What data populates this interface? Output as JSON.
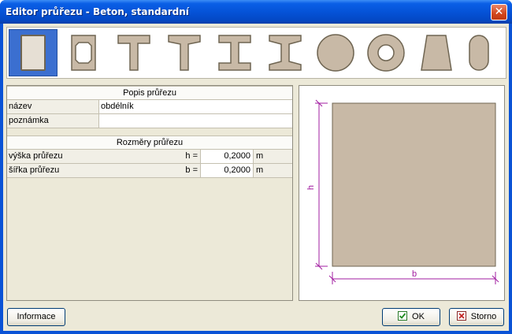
{
  "window": {
    "title": "Editor průřezu - Beton, standardní",
    "close_glyph": "✕"
  },
  "shapes": [
    {
      "name": "rectangle",
      "selected": true
    },
    {
      "name": "hollow-rectangle",
      "selected": false
    },
    {
      "name": "t-section",
      "selected": false
    },
    {
      "name": "t-section-tapered",
      "selected": false
    },
    {
      "name": "i-section",
      "selected": false
    },
    {
      "name": "i-section-tapered",
      "selected": false
    },
    {
      "name": "circle",
      "selected": false
    },
    {
      "name": "hollow-circle",
      "selected": false
    },
    {
      "name": "trapezoid",
      "selected": false
    },
    {
      "name": "oval",
      "selected": false
    }
  ],
  "description": {
    "header": "Popis průřezu",
    "name_label": "název",
    "name_value": "obdélník",
    "note_label": "poznámka",
    "note_value": ""
  },
  "dimensions": {
    "header": "Rozměry průřezu",
    "rows": [
      {
        "label": "výška průřezu",
        "symbol": "h =",
        "value": "0,2000",
        "unit": "m"
      },
      {
        "label": "šířka průřezu",
        "symbol": "b =",
        "value": "0,2000",
        "unit": "m"
      }
    ]
  },
  "preview": {
    "h_label": "h",
    "b_label": "b",
    "fill_color": "#c8b9a6",
    "dim_color": "#a21ca0"
  },
  "buttons": {
    "info": "Informace",
    "ok": "OK",
    "cancel": "Storno"
  },
  "colors": {
    "shape_fill": "#c8b9a6",
    "shape_stroke": "#6f6552",
    "selection": "#3b6fd0"
  }
}
